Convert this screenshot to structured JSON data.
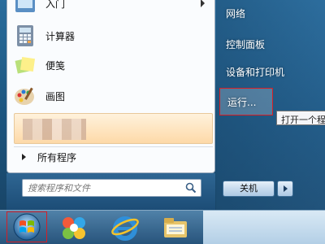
{
  "start_menu": {
    "programs": [
      {
        "label": "入门",
        "icon": "getting-started-icon",
        "has_submenu": true
      },
      {
        "label": "计算器",
        "icon": "calculator-icon",
        "has_submenu": false
      },
      {
        "label": "便笺",
        "icon": "sticky-notes-icon",
        "has_submenu": false
      },
      {
        "label": "画图",
        "icon": "paint-icon",
        "has_submenu": false
      }
    ],
    "all_programs_label": "所有程序",
    "search": {
      "placeholder": "搜索程序和文件"
    },
    "right_items": {
      "network": "网络",
      "control_panel": "控制面板",
      "devices_printers": "设备和打印机",
      "run": "运行..."
    },
    "tooltip": "打开一个程序",
    "shutdown_label": "关机"
  },
  "taskbar": {
    "icons": [
      "windows-start-icon",
      "qq-browser-icon",
      "internet-explorer-icon",
      "file-explorer-icon"
    ]
  },
  "colors": {
    "highlight_box": "#d61f26",
    "selected_item": "#fdd9a8"
  }
}
